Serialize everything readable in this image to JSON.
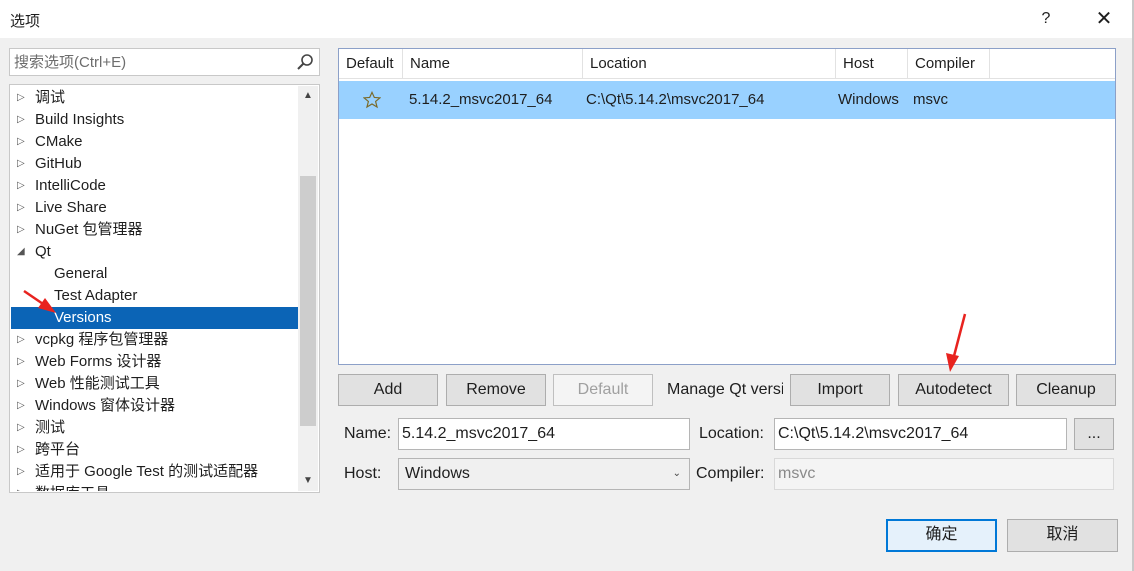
{
  "window": {
    "title": "选项",
    "help_label": "?",
    "close_label": "✕"
  },
  "search": {
    "placeholder": "搜索选项(Ctrl+E)"
  },
  "tree": {
    "items": [
      {
        "label": "调试",
        "expander": "▷"
      },
      {
        "label": "Build Insights",
        "expander": "▷"
      },
      {
        "label": "CMake",
        "expander": "▷"
      },
      {
        "label": "GitHub",
        "expander": "▷"
      },
      {
        "label": "IntelliCode",
        "expander": "▷"
      },
      {
        "label": "Live Share",
        "expander": "▷"
      },
      {
        "label": "NuGet 包管理器",
        "expander": "▷"
      },
      {
        "label": "Qt",
        "expander": "◢"
      },
      {
        "label": "General",
        "expander": ""
      },
      {
        "label": "Test Adapter",
        "expander": ""
      },
      {
        "label": "Versions",
        "expander": ""
      },
      {
        "label": "vcpkg 程序包管理器",
        "expander": "▷"
      },
      {
        "label": "Web Forms 设计器",
        "expander": "▷"
      },
      {
        "label": "Web 性能测试工具",
        "expander": "▷"
      },
      {
        "label": "Windows 窗体设计器",
        "expander": "▷"
      },
      {
        "label": "测试",
        "expander": "▷"
      },
      {
        "label": "跨平台",
        "expander": "▷"
      },
      {
        "label": "适用于 Google Test 的测试适配器",
        "expander": "▷"
      },
      {
        "label": "数据库工具",
        "expander": "▷"
      }
    ],
    "selected": "Versions"
  },
  "versions_table": {
    "columns": [
      "Default",
      "Name",
      "Location",
      "Host",
      "Compiler"
    ],
    "rows": [
      {
        "name": "5.14.2_msvc2017_64",
        "location": "C:\\Qt\\5.14.2\\msvc2017_64",
        "host": "Windows",
        "compiler": "msvc",
        "is_default": true
      }
    ]
  },
  "actions": {
    "add": "Add",
    "remove": "Remove",
    "default": "Default",
    "manage_label": "Manage Qt versions",
    "import": "Import",
    "autodetect": "Autodetect",
    "cleanup": "Cleanup"
  },
  "form": {
    "name_label": "Name:",
    "name_value": "5.14.2_msvc2017_64",
    "location_label": "Location:",
    "location_value": "C:\\Qt\\5.14.2\\msvc2017_64",
    "browse_label": "...",
    "host_label": "Host:",
    "host_value": "Windows",
    "compiler_label": "Compiler:",
    "compiler_value": "msvc"
  },
  "dialog_buttons": {
    "ok": "确定",
    "cancel": "取消"
  },
  "colors": {
    "selection": "#0b64b6",
    "row_highlight": "#99d1ff",
    "primary_border": "#0078d7",
    "annotation": "#e8231f"
  }
}
